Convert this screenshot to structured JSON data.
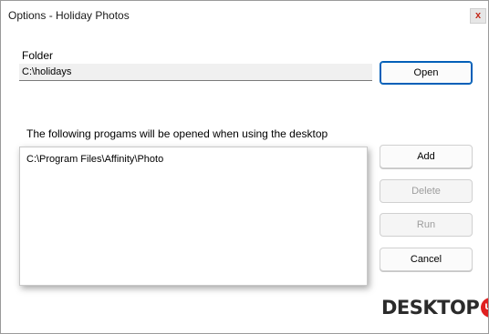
{
  "window": {
    "title": "Options - Holiday Photos",
    "close_glyph": "x"
  },
  "folder": {
    "label": "Folder",
    "value": "C:\\holidays",
    "open_label": "Open"
  },
  "programs": {
    "label": "The following progams will be opened when using the desktop",
    "items": [
      "C:\\Program Files\\Affinity\\Photo"
    ]
  },
  "buttons": {
    "add_label": "Add",
    "delete_label": "Delete",
    "run_label": "Run",
    "cancel_label": "Cancel"
  },
  "logo": {
    "text": "DESKTOP",
    "badge": "UP",
    "brand_color": "#e02020"
  },
  "colors": {
    "accent": "#005fb8",
    "close_glyph": "#c42b1c"
  }
}
